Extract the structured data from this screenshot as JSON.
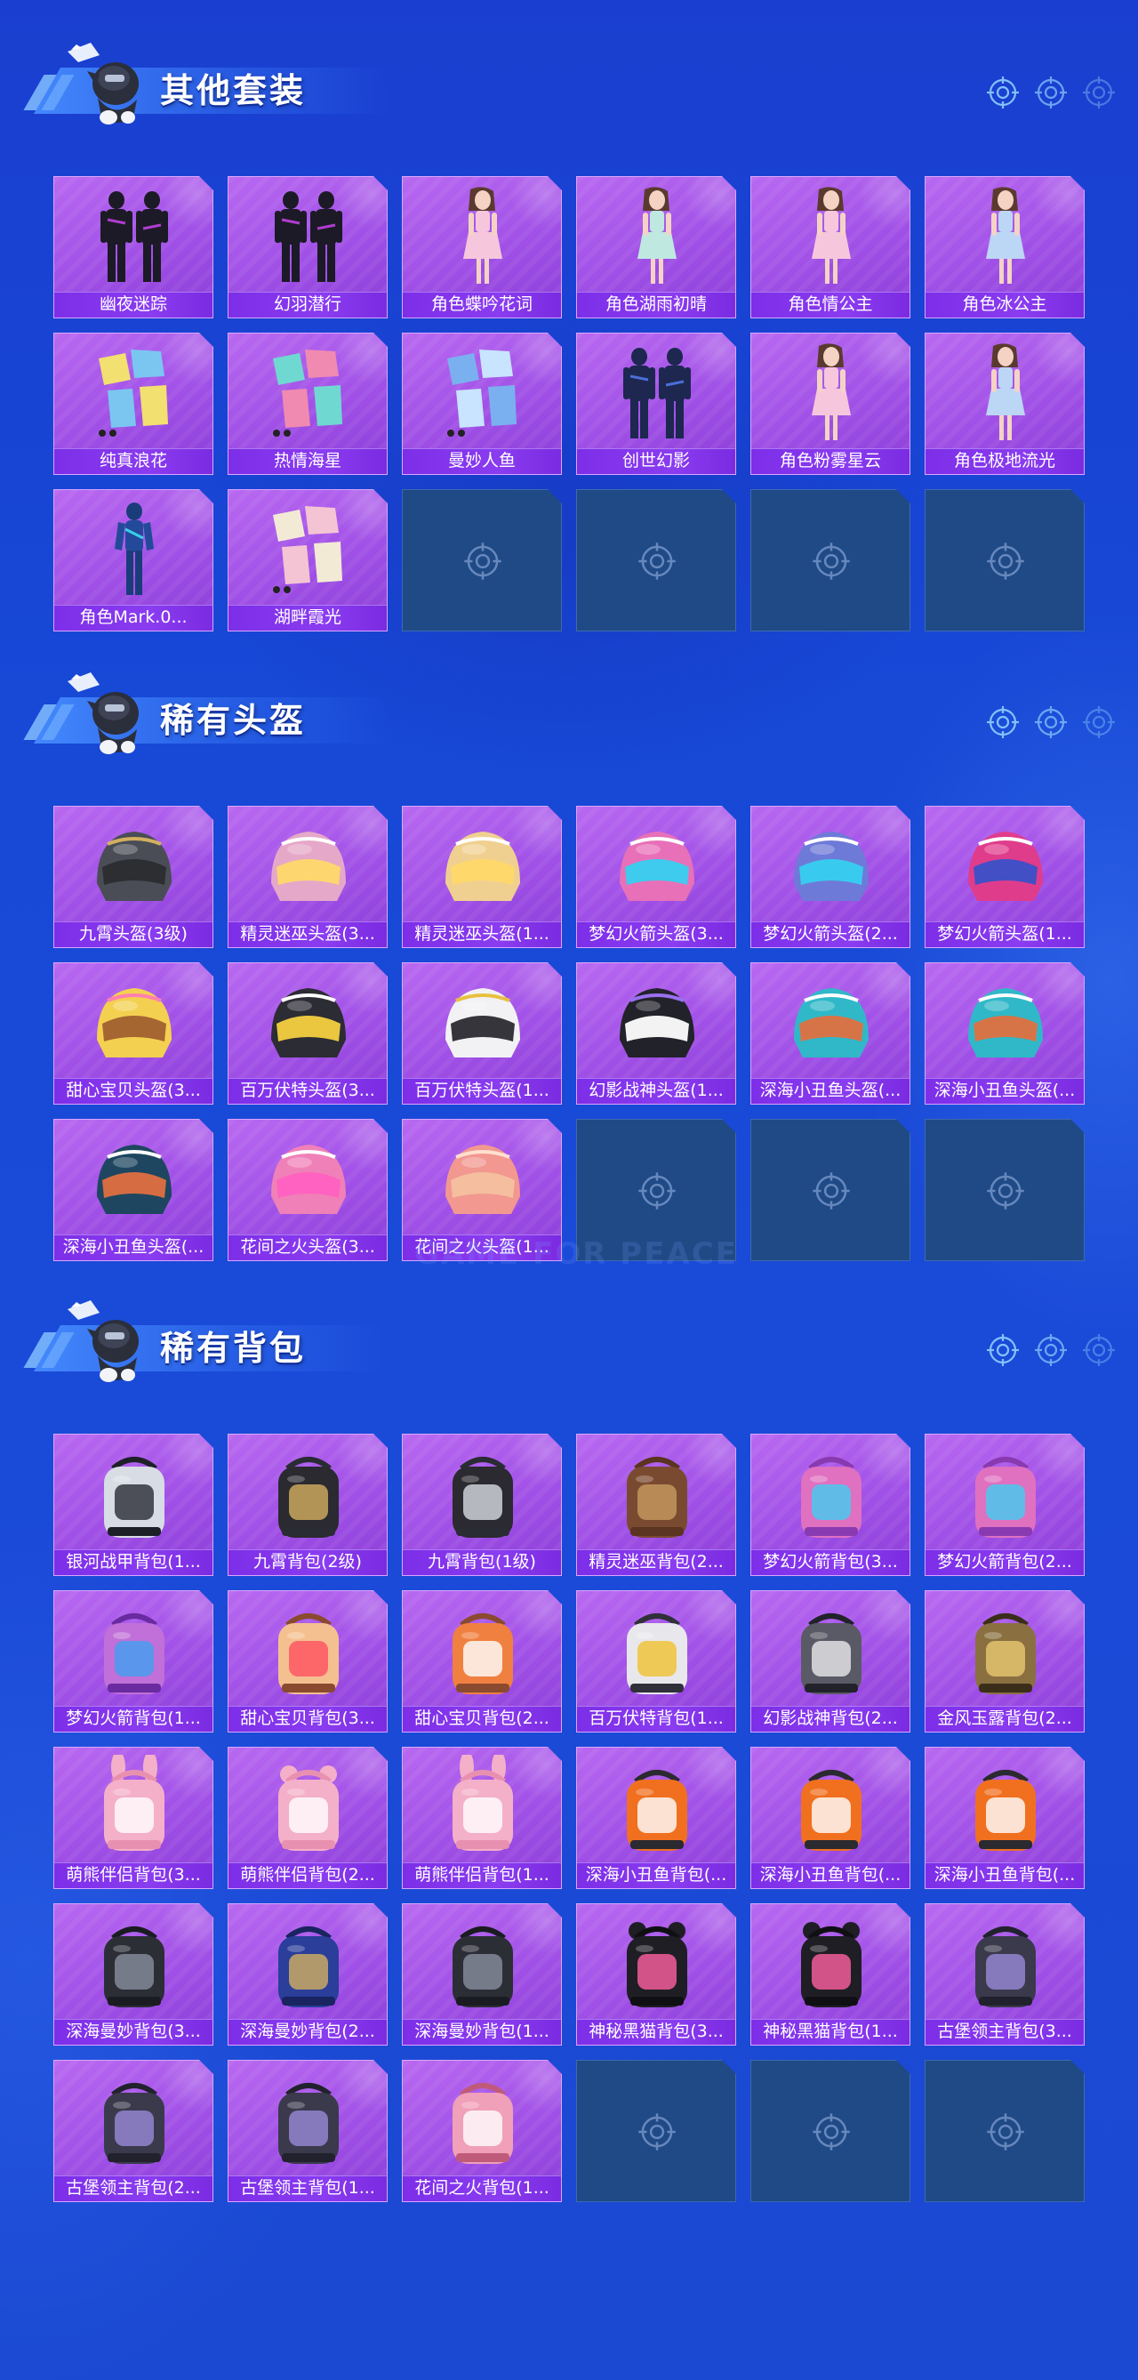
{
  "colors": {
    "background": "#1a45d4",
    "card": "#a050e6",
    "card_label": "#7d2ee8",
    "empty_slot": "#1f4a86"
  },
  "watermark": "GAME FOR PEACE",
  "sections": [
    {
      "title": "其他套装",
      "items": [
        {
          "label": "幽夜迷踪",
          "art": "outfit-dark"
        },
        {
          "label": "幻羽潜行",
          "art": "outfit-dark"
        },
        {
          "label": "角色蝶吟花词",
          "art": "outfit-girl-pink"
        },
        {
          "label": "角色湖雨初晴",
          "art": "outfit-girl-mint"
        },
        {
          "label": "角色情公主",
          "art": "outfit-girl-pink"
        },
        {
          "label": "角色冰公主",
          "art": "outfit-girl-ice"
        },
        {
          "label": "纯真浪花",
          "art": "outfit-pieces-yellow"
        },
        {
          "label": "热情海星",
          "art": "outfit-pieces-teal"
        },
        {
          "label": "曼妙人鱼",
          "art": "outfit-pieces-blue"
        },
        {
          "label": "创世幻影",
          "art": "outfit-dark-blue"
        },
        {
          "label": "角色粉雾星云",
          "art": "outfit-girl-pink"
        },
        {
          "label": "角色极地流光",
          "art": "outfit-girl-ice"
        },
        {
          "label": "角色Mark.0...",
          "art": "outfit-suit-blue"
        },
        {
          "label": "湖畔霞光",
          "art": "outfit-pieces-cream"
        }
      ],
      "empty_count": 4
    },
    {
      "title": "稀有头盔",
      "items": [
        {
          "label": "九霄头盔(3级)",
          "art": "helmet-gold"
        },
        {
          "label": "精灵迷巫头盔(3...",
          "art": "helmet-winged-pink"
        },
        {
          "label": "精灵迷巫头盔(1...",
          "art": "helmet-winged-gold"
        },
        {
          "label": "梦幻火箭头盔(3...",
          "art": "helmet-rocket-pink"
        },
        {
          "label": "梦幻火箭头盔(2...",
          "art": "helmet-rocket-blue"
        },
        {
          "label": "梦幻火箭头盔(1...",
          "art": "helmet-round-pink"
        },
        {
          "label": "甜心宝贝头盔(3...",
          "art": "helmet-cake"
        },
        {
          "label": "百万伏特头盔(3...",
          "art": "helmet-volt-yellow"
        },
        {
          "label": "百万伏特头盔(1...",
          "art": "helmet-volt-white"
        },
        {
          "label": "幻影战神头盔(1...",
          "art": "helmet-phantom"
        },
        {
          "label": "深海小丑鱼头盔(...",
          "art": "helmet-fish-teal"
        },
        {
          "label": "深海小丑鱼头盔(...",
          "art": "helmet-fish-teal-round"
        },
        {
          "label": "深海小丑鱼头盔(...",
          "art": "helmet-fish-dark"
        },
        {
          "label": "花间之火头盔(3...",
          "art": "helmet-flower"
        },
        {
          "label": "花间之火头盔(1...",
          "art": "helmet-peach"
        }
      ],
      "empty_count": 3
    },
    {
      "title": "稀有背包",
      "items": [
        {
          "label": "银河战甲背包(1...",
          "art": "bag-galaxy"
        },
        {
          "label": "九霄背包(2级)",
          "art": "bag-gold-black"
        },
        {
          "label": "九霄背包(1级)",
          "art": "bag-silver-black"
        },
        {
          "label": "精灵迷巫背包(2...",
          "art": "bag-brown"
        },
        {
          "label": "梦幻火箭背包(3...",
          "art": "bag-rocket-pink"
        },
        {
          "label": "梦幻火箭背包(2...",
          "art": "bag-rocket-pink"
        },
        {
          "label": "梦幻火箭背包(1...",
          "art": "bag-rocket-purple"
        },
        {
          "label": "甜心宝贝背包(3...",
          "art": "bag-cake"
        },
        {
          "label": "甜心宝贝背包(2...",
          "art": "bag-cake-orange"
        },
        {
          "label": "百万伏特背包(1...",
          "art": "bag-volt"
        },
        {
          "label": "幻影战神背包(2...",
          "art": "bag-phantom"
        },
        {
          "label": "金风玉露背包(2...",
          "art": "bag-gold-ornate"
        },
        {
          "label": "萌熊伴侣背包(3...",
          "art": "bag-bunny-pink"
        },
        {
          "label": "萌熊伴侣背包(2...",
          "art": "bag-bear-pink"
        },
        {
          "label": "萌熊伴侣背包(1...",
          "art": "bag-bunny-face"
        },
        {
          "label": "深海小丑鱼背包(...",
          "art": "bag-clownfish"
        },
        {
          "label": "深海小丑鱼背包(...",
          "art": "bag-clownfish"
        },
        {
          "label": "深海小丑鱼背包(...",
          "art": "bag-clownfish"
        },
        {
          "label": "深海曼妙背包(3...",
          "art": "bag-tanks"
        },
        {
          "label": "深海曼妙背包(2...",
          "art": "bag-shell-blue"
        },
        {
          "label": "深海曼妙背包(1...",
          "art": "bag-tank-single"
        },
        {
          "label": "神秘黑猫背包(3...",
          "art": "bag-cat-black"
        },
        {
          "label": "神秘黑猫背包(1...",
          "art": "bag-cat-black"
        },
        {
          "label": "古堡领主背包(3...",
          "art": "bag-castle-dark"
        },
        {
          "label": "古堡领主背包(2...",
          "art": "bag-castle-dark"
        },
        {
          "label": "古堡领主背包(1...",
          "art": "bag-castle-dark"
        },
        {
          "label": "花间之火背包(1...",
          "art": "bag-flower-pink"
        }
      ],
      "empty_count": 3
    }
  ]
}
